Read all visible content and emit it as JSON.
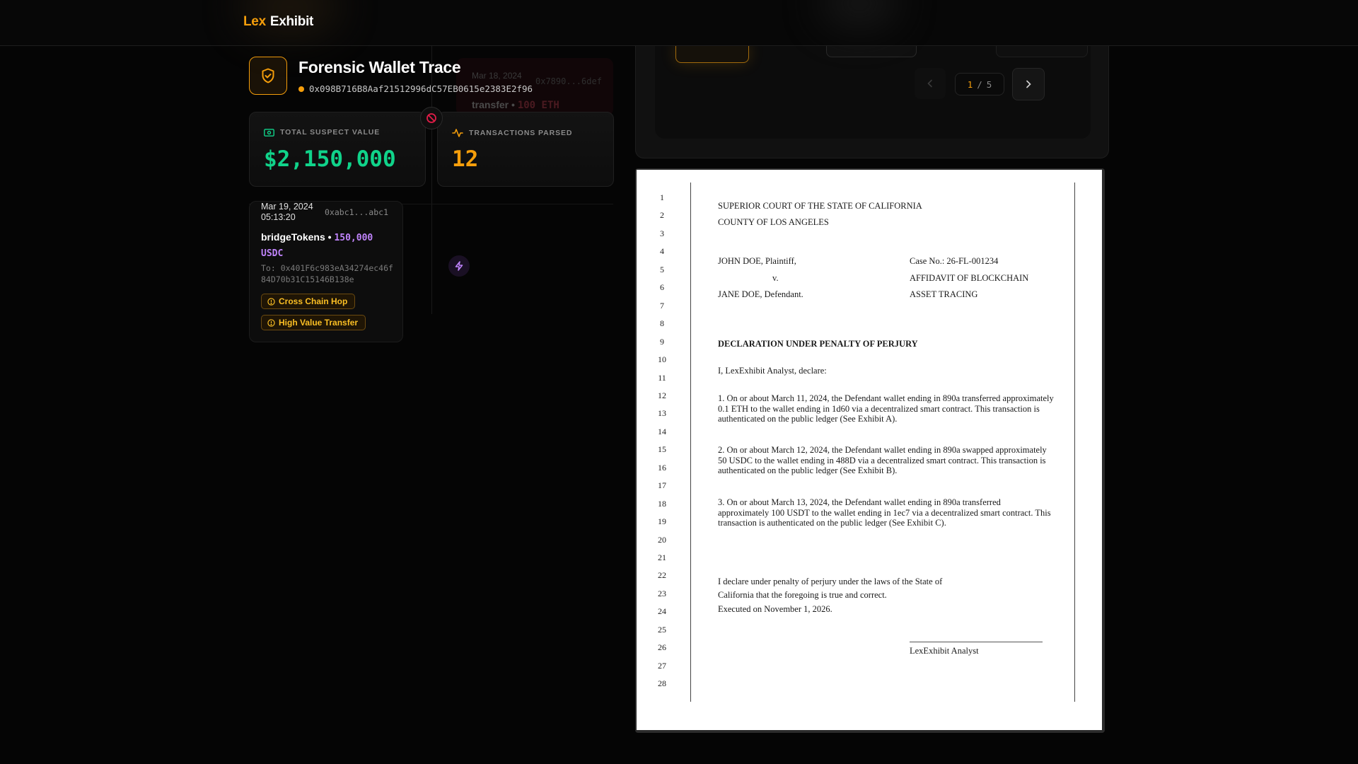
{
  "app": {
    "logo_lex": "Lex",
    "logo_exhibit": "Exhibit"
  },
  "header": {
    "title": "Forensic Wallet Trace",
    "wallet_address": "0x098B716B8Aaf21512996dC57EB0615e2383E2f96"
  },
  "ghost_event": {
    "date": "Mar 18, 2024",
    "hash": "0x7890...6def",
    "method": "transfer",
    "amount": "100 ETH"
  },
  "stats": {
    "suspect_label": "TOTAL SUSPECT VALUE",
    "suspect_value": "$2,150,000",
    "tx_label": "TRANSACTIONS PARSED",
    "tx_value": "12"
  },
  "event": {
    "date_line1": "Mar 19, 2024",
    "date_line2": "05:13:20",
    "hash": "0xabc1...abc1",
    "method": "bridgeTokens",
    "bullet": "•",
    "amount": "150,000 USDC",
    "to": "To: 0x401F6c983eA34274ec46f84D70b31C15146B138e",
    "tags": [
      "Cross Chain Hop",
      "High Value Transfer"
    ]
  },
  "pager": {
    "current": "1",
    "separator": "/",
    "total": "5"
  },
  "document": {
    "line_numbers": [
      "1",
      "2",
      "3",
      "4",
      "5",
      "6",
      "7",
      "8",
      "9",
      "10",
      "11",
      "12",
      "13",
      "14",
      "15",
      "16",
      "17",
      "18",
      "19",
      "20",
      "21",
      "22",
      "23",
      "24",
      "25",
      "26",
      "27",
      "28"
    ],
    "court_line1": "SUPERIOR COURT OF THE STATE OF CALIFORNIA",
    "court_line2": "COUNTY OF LOS ANGELES",
    "plaintiff": "JOHN DOE, Plaintiff,",
    "versus": "v.",
    "defendant": "JANE DOE, Defendant.",
    "case_no": "Case No.: 26-FL-001234",
    "doc_title_line1": "AFFIDAVIT OF BLOCKCHAIN",
    "doc_title_line2": "ASSET TRACING",
    "heading": "DECLARATION UNDER PENALTY OF PERJURY",
    "intro": "I, LexExhibit Analyst, declare:",
    "para1": "1. On or about March 11, 2024, the Defendant wallet ending in 890a transferred approximately 0.1 ETH to the wallet ending in 1d60 via a decentralized smart contract. This transaction is authenticated on the public ledger (See Exhibit A).",
    "para2": "2. On or about March 12, 2024, the Defendant wallet ending in 890a swapped approximately 50 USDC to the wallet ending in 488D via a decentralized smart contract. This transaction is authenticated on the public ledger (See Exhibit B).",
    "para3": "3. On or about March 13, 2024, the Defendant wallet ending in 890a transferred approximately 100 USDT to the wallet ending in 1ec7 via a decentralized smart contract. This transaction is authenticated on the public ledger (See Exhibit C).",
    "closing_line1": "I declare under penalty of perjury under the laws of the State of",
    "closing_line2": "California that the foregoing is true and correct.",
    "closing_line3": "Executed on November 1, 2026.",
    "signature_name": "LexExhibit Analyst"
  },
  "colors": {
    "accent": "#f59e0b",
    "success": "#10d38a",
    "purple": "#c084fc",
    "danger": "#e11d48"
  },
  "icons": [
    "shield-check-icon",
    "dollar-bill-icon",
    "activity-pulse-icon",
    "block-icon",
    "alert-circle-icon",
    "bolt-icon",
    "chevron-left-icon",
    "chevron-right-icon"
  ]
}
